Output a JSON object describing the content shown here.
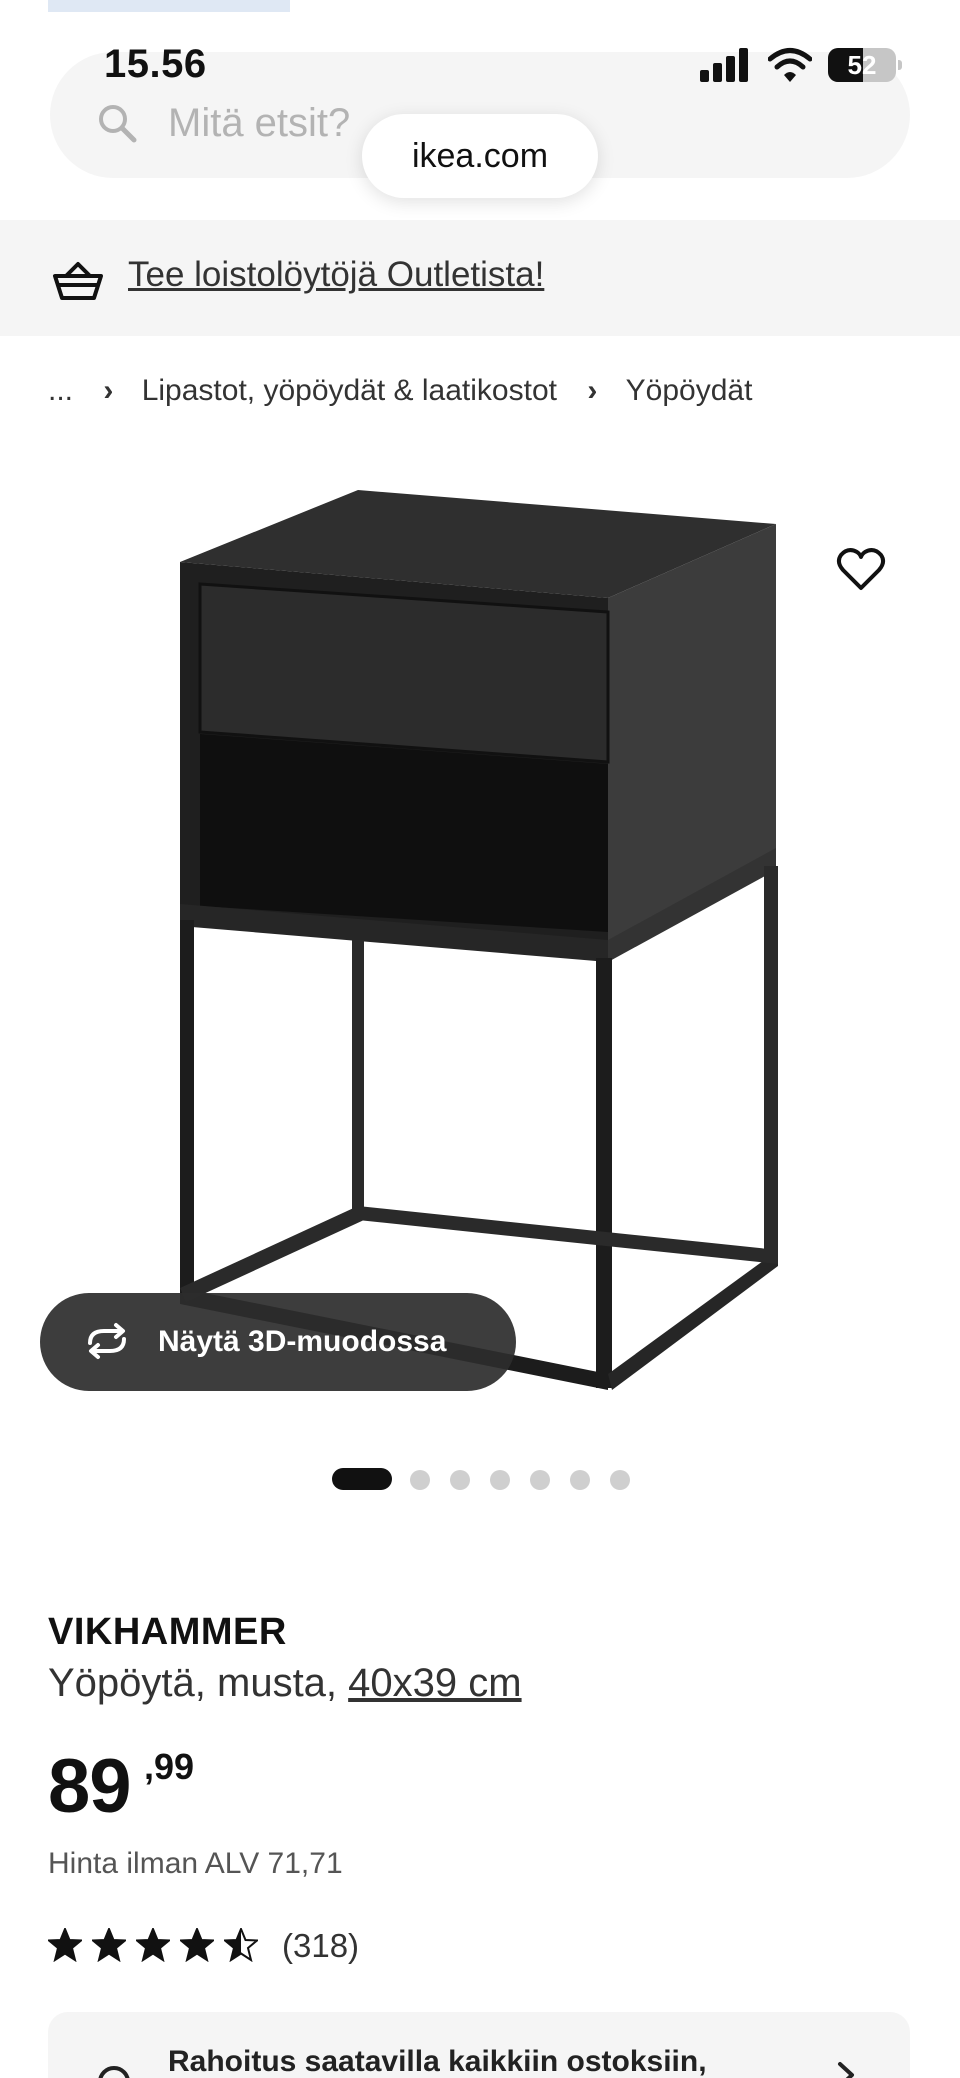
{
  "status_bar": {
    "time": "15.56",
    "battery_level": "52",
    "battery_fraction": 0.52
  },
  "search": {
    "placeholder": "Mitä etsit?"
  },
  "browser": {
    "url": "ikea.com"
  },
  "promo": {
    "link_text": "Tee loistolöytöjä Outletista!"
  },
  "breadcrumb": {
    "ellipsis": "...",
    "items": [
      "Lipastot, yöpöydät & laatikostot",
      "Yöpöydät"
    ]
  },
  "gallery": {
    "view_3d_label": "Näytä 3D-muodossa",
    "image_count": 7,
    "active_index": 0
  },
  "product": {
    "name": "VIKHAMMER",
    "description": "Yöpöytä, musta, ",
    "size": "40x39 cm",
    "price_main": "89",
    "price_decimals": ",99",
    "price_without_vat": "Hinta ilman ALV 71,71",
    "rating": 4.5,
    "review_count": "(318)"
  },
  "financing": {
    "text": "Rahoitus saatavilla kaikkiin ostoksiin,"
  },
  "icons": {
    "search": "search-icon",
    "basket": "basket-icon",
    "heart": "heart-icon",
    "rotate": "rotate-3d-icon",
    "chevron": "chevron-right-icon"
  },
  "colors": {
    "text_primary": "#111111",
    "panel_bg": "#f5f5f5",
    "button_dark": "#2d2d2d"
  }
}
